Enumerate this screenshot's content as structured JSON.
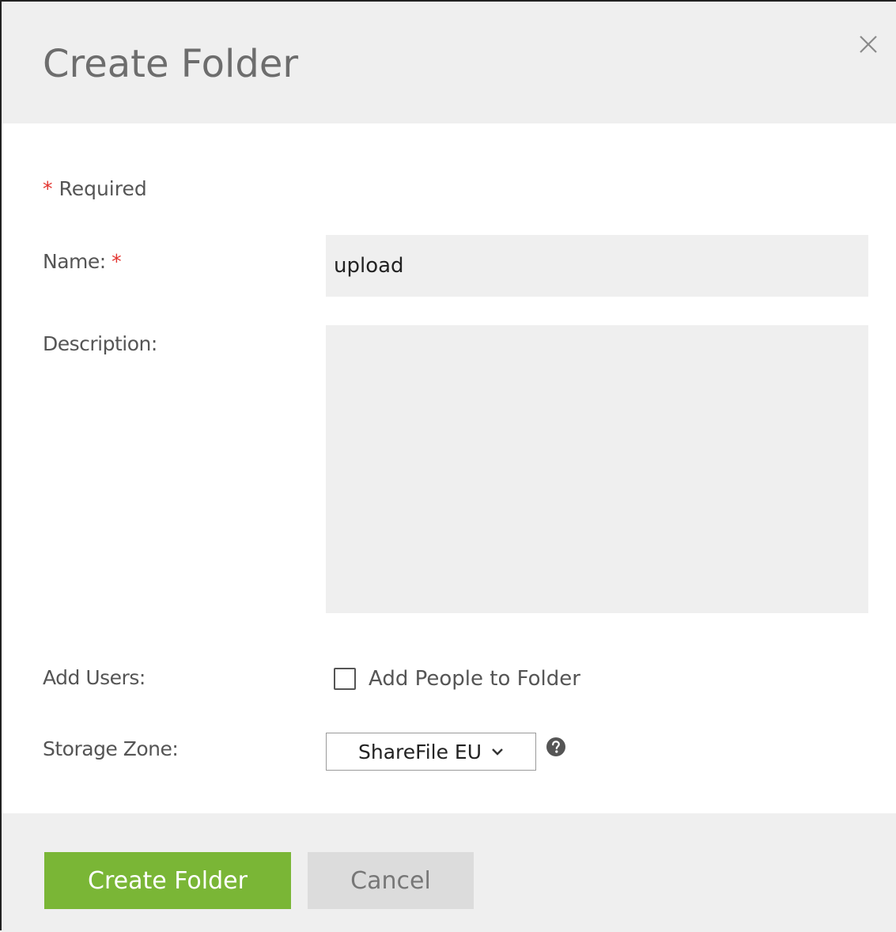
{
  "dialog": {
    "title": "Create Folder",
    "close_icon": "close-icon"
  },
  "form": {
    "required_star": "*",
    "required_note": "Required",
    "name": {
      "label": "Name:",
      "star": "*",
      "value": "upload"
    },
    "description": {
      "label": "Description:",
      "value": ""
    },
    "add_users": {
      "label": "Add Users:",
      "checkbox_label": "Add People to Folder",
      "checked": false
    },
    "storage_zone": {
      "label": "Storage Zone:",
      "selected": "ShareFile EU",
      "help_icon": "question-circle-icon"
    }
  },
  "footer": {
    "create_label": "Create Folder",
    "cancel_label": "Cancel"
  },
  "colors": {
    "primary_button": "#7ab636",
    "required_star": "#e3342f",
    "panel_background": "#efefef"
  }
}
